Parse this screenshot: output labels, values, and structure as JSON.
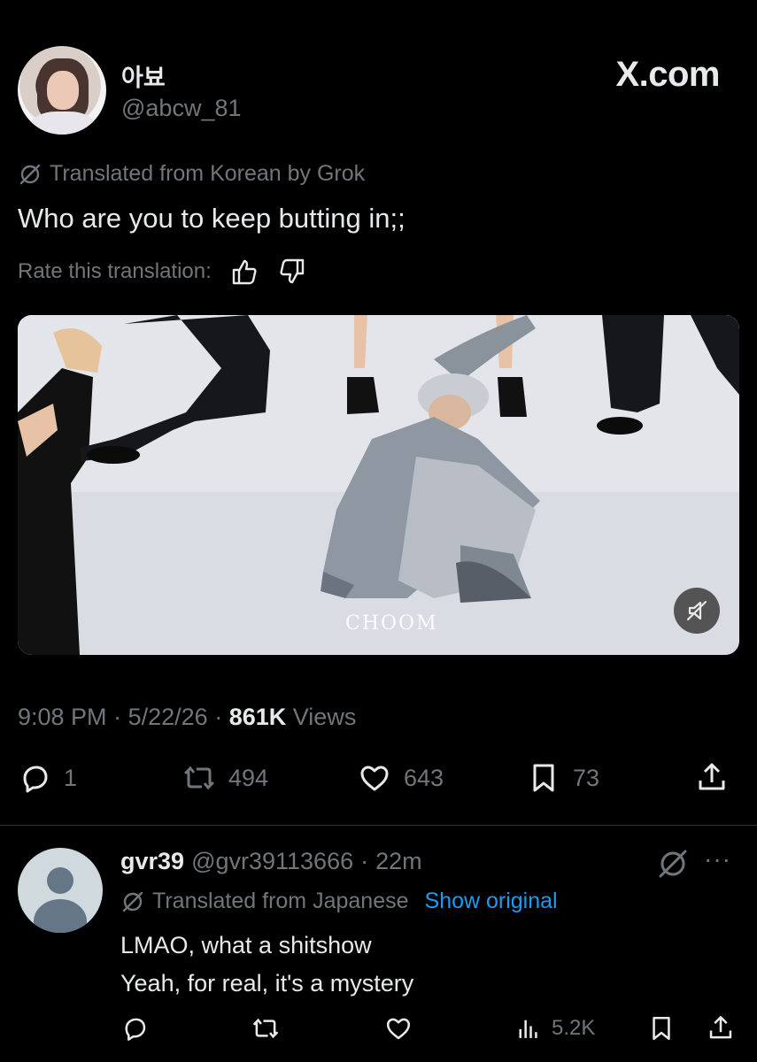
{
  "header": {
    "display_name": "아뵤",
    "handle": "@abcw_81",
    "brand": "X.com"
  },
  "post": {
    "translated_label": "Translated from Korean by Grok",
    "text": "Who are you to keep butting in;;",
    "rate_label": "Rate this translation:",
    "media_watermark": "CHOOM",
    "time": "9:08 PM",
    "separator": "·",
    "date": "5/22/26",
    "views_count": "861K",
    "views_label": "Views",
    "replies": "1",
    "reposts": "494",
    "likes": "643",
    "bookmarks": "73"
  },
  "reply": {
    "display_name": "gvr39",
    "handle": "@gvr39113666",
    "separator": "·",
    "time_ago": "22m",
    "more": "···",
    "translated_label": "Translated from Japanese",
    "show_original": "Show original",
    "line1": "LMAO, what a shitshow",
    "line2": "Yeah, for real, it's a mystery",
    "views": "5.2K"
  },
  "icons": {
    "grok_slash": "grok-icon",
    "thumbs_up": "thumbs-up-icon",
    "thumbs_down": "thumbs-down-icon",
    "mute": "mute-icon",
    "reply": "reply-icon",
    "repost": "repost-icon",
    "like": "heart-icon",
    "bookmark": "bookmark-icon",
    "share": "share-icon",
    "views": "views-icon"
  },
  "colors": {
    "background": "#000000",
    "text": "#e7e9ea",
    "muted": "#71767b",
    "link": "#1d9bf0",
    "divider": "#2f3336"
  }
}
